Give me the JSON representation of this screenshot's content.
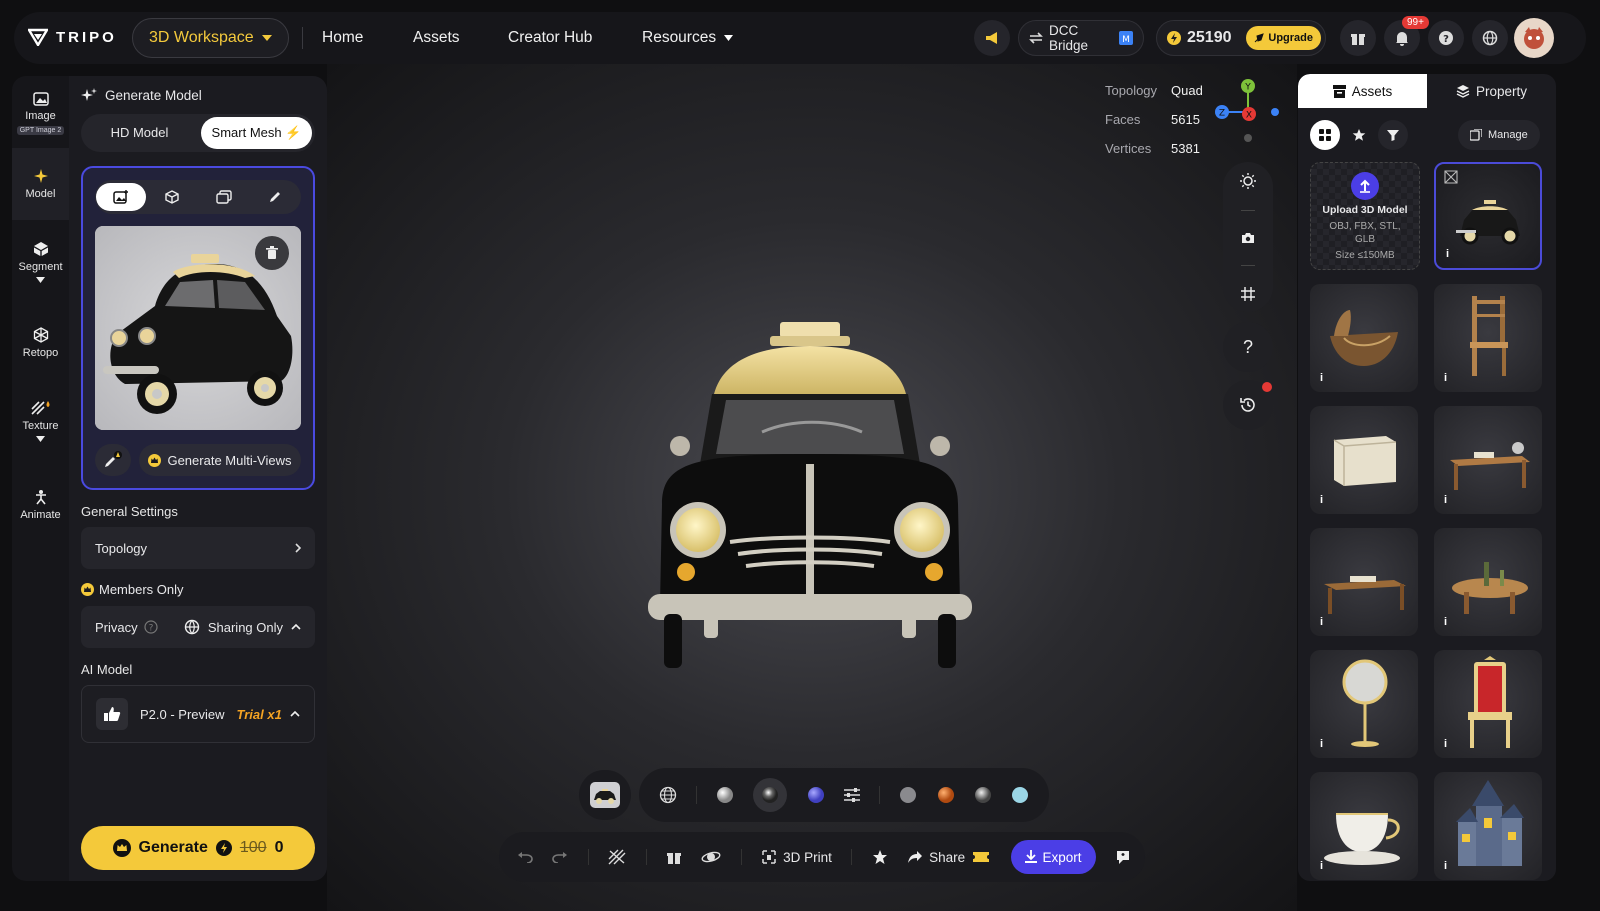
{
  "topbar": {
    "logo_text": "TRIPO",
    "workspace_label": "3D Workspace",
    "nav": [
      "Home",
      "Assets",
      "Creator Hub",
      "Resources"
    ],
    "dcc_bridge_label": "DCC Bridge",
    "credits": "25190",
    "upgrade_label": "Upgrade",
    "notif_badge": "99+"
  },
  "rail": {
    "items": [
      {
        "label": "Image",
        "badge": "GPT Image 2"
      },
      {
        "label": "Model"
      },
      {
        "label": "Segment"
      },
      {
        "label": "Retopo"
      },
      {
        "label": "Texture"
      },
      {
        "label": "Animate"
      }
    ]
  },
  "panel": {
    "title": "Generate Model",
    "mode_tabs": [
      "HD Model",
      "Smart Mesh"
    ],
    "generate_multiviews": "Generate Multi-Views",
    "general_settings": "General Settings",
    "topology_label": "Topology",
    "members_only": "Members Only",
    "privacy_label": "Privacy",
    "privacy_value": "Sharing Only",
    "ai_model_label": "AI Model",
    "ai_model_value": "P2.0 - Preview",
    "trial_label": "Trial x1",
    "generate_label": "Generate",
    "cost_old": "100",
    "cost_new": "0"
  },
  "viewport": {
    "stats": [
      {
        "label": "Topology",
        "value": "Quad"
      },
      {
        "label": "Faces",
        "value": "5615"
      },
      {
        "label": "Vertices",
        "value": "5381"
      }
    ],
    "axes": {
      "x": "X",
      "y": "Y",
      "z": "Z"
    },
    "bottom": {
      "print_label": "3D Print",
      "share_label": "Share",
      "export_label": "Export"
    },
    "colors": {
      "accent": "#4b3ee6",
      "brand": "#f4c93a"
    }
  },
  "rpanel": {
    "tabs": [
      "Assets",
      "Property"
    ],
    "manage_label": "Manage",
    "upload": {
      "title": "Upload 3D Model",
      "formats": "OBJ, FBX, STL, GLB",
      "size": "Size ≤150MB"
    },
    "info_glyph": "i"
  }
}
